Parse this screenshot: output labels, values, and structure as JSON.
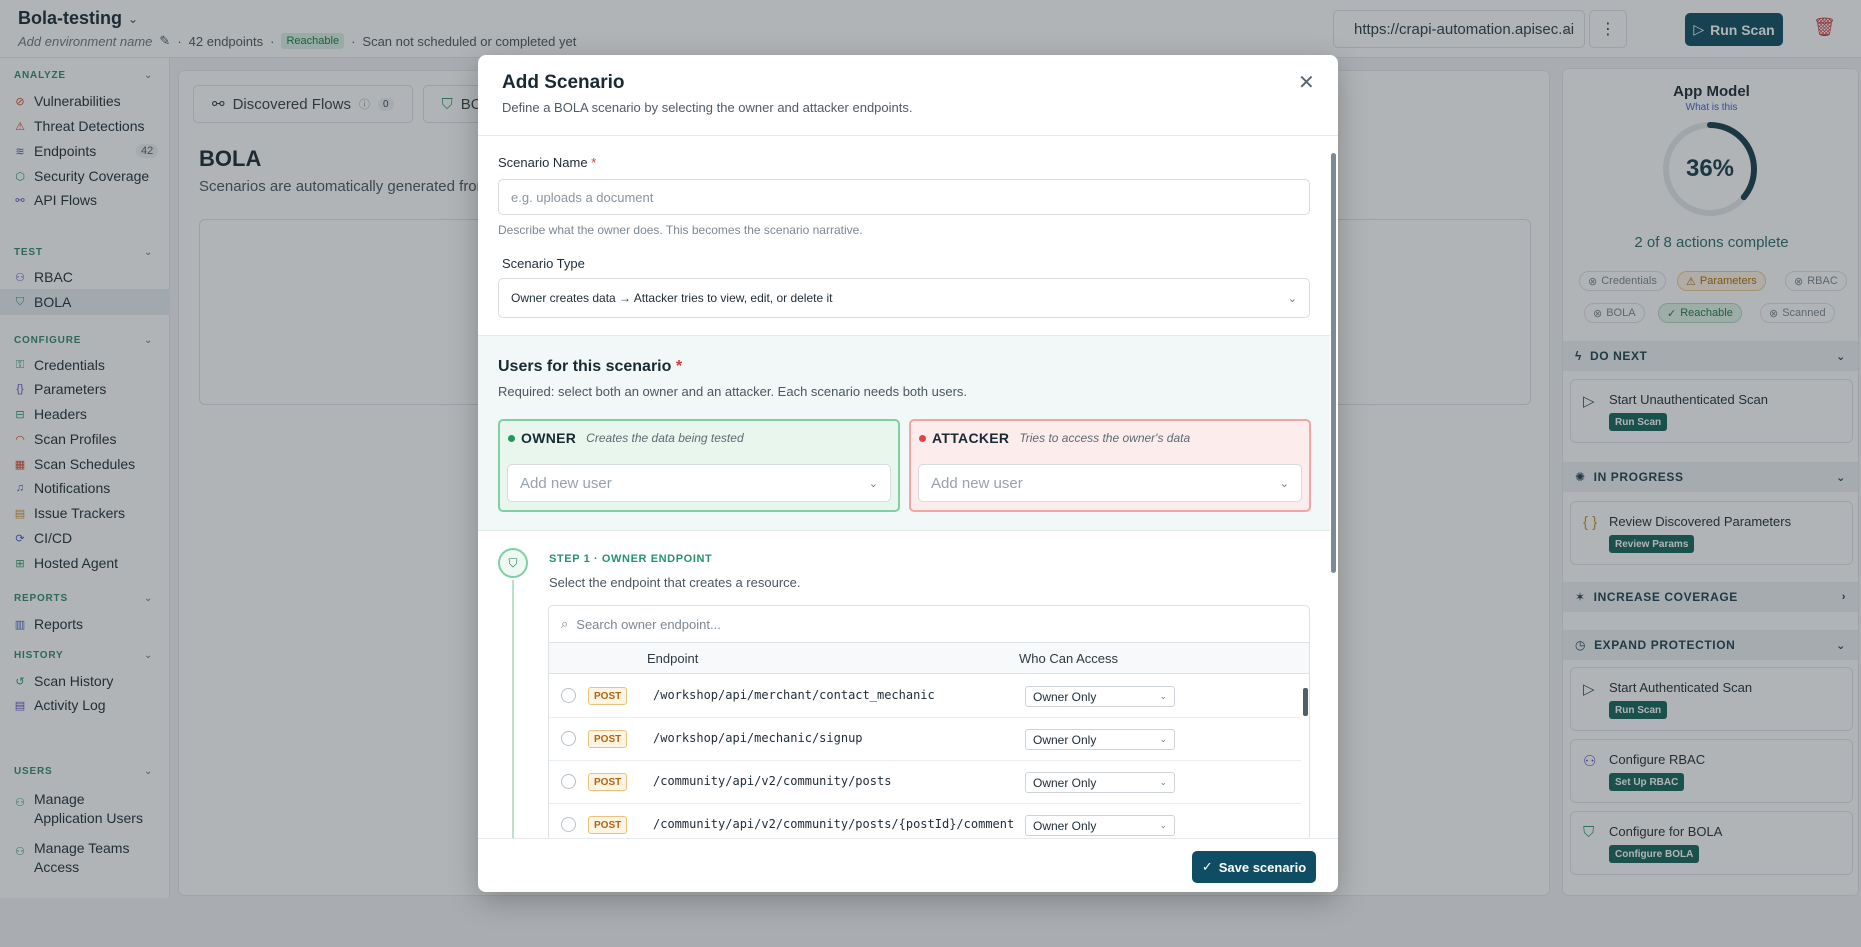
{
  "header": {
    "env_title": "Bola-testing",
    "add_env_name": "Add environment name",
    "endpoints_count": "42 endpoints",
    "reachable_badge": "Reachable",
    "scan_status": "Scan not scheduled or completed yet",
    "url": "https://crapi-automation.apisec.ai",
    "run_scan": "Run Scan"
  },
  "sidebar": {
    "sections": {
      "analyze": "ANALYZE",
      "test": "TEST",
      "configure": "CONFIGURE",
      "reports": "REPORTS",
      "history": "HISTORY",
      "users": "USERS"
    },
    "items": {
      "vulnerabilities": "Vulnerabilities",
      "threat_detections": "Threat Detections",
      "endpoints": "Endpoints",
      "endpoints_count": "42",
      "security_coverage": "Security Coverage",
      "api_flows": "API Flows",
      "rbac": "RBAC",
      "bola": "BOLA",
      "credentials": "Credentials",
      "parameters": "Parameters",
      "headers": "Headers",
      "scan_profiles": "Scan Profiles",
      "scan_schedules": "Scan Schedules",
      "notifications": "Notifications",
      "issue_trackers": "Issue Trackers",
      "cicd": "CI/CD",
      "hosted_agent": "Hosted Agent",
      "reports": "Reports",
      "scan_history": "Scan History",
      "activity_log": "Activity Log",
      "manage_app_users": "Manage Application Users",
      "manage_teams": "Manage Teams Access"
    }
  },
  "main": {
    "tab_discovered": "Discovered Flows",
    "tab_discovered_count": "0",
    "tab_bola": "BO",
    "title": "BOLA",
    "subtitle": "Scenarios are automatically generated from"
  },
  "right_panel": {
    "title": "App Model",
    "what_link": "What is this",
    "percent": "36%",
    "percent_value": 36,
    "actions_complete": "2 of 8 actions complete",
    "chips": {
      "credentials": "Credentials",
      "parameters": "Parameters",
      "rbac": "RBAC",
      "bola": "BOLA",
      "reachable": "Reachable",
      "scanned": "Scanned"
    },
    "sections": {
      "do_next": "DO NEXT",
      "in_progress": "IN PROGRESS",
      "increase_coverage": "INCREASE COVERAGE",
      "expand_protection": "EXPAND PROTECTION"
    },
    "cards": {
      "unauth_scan": "Start Unauthenticated Scan",
      "unauth_btn": "Run Scan",
      "review_params": "Review Discovered Parameters",
      "review_btn": "Review Params",
      "auth_scan": "Start Authenticated Scan",
      "auth_btn": "Run Scan",
      "config_rbac": "Configure RBAC",
      "rbac_btn": "Set Up RBAC",
      "config_bola": "Configure for BOLA",
      "bola_btn": "Configure BOLA"
    }
  },
  "modal": {
    "title": "Add Scenario",
    "subtitle": "Define a BOLA scenario by selecting the owner and attacker endpoints.",
    "scenario_name_label": "Scenario Name",
    "scenario_name_placeholder": "e.g. uploads a document",
    "scenario_name_hint": "Describe what the owner does. This becomes the scenario narrative.",
    "scenario_type_label": "Scenario Type",
    "scenario_type_value": "Owner creates data → Attacker tries to view, edit, or delete it",
    "users_title": "Users for this scenario",
    "users_sub": "Required: select both an owner and an attacker. Each scenario needs both users.",
    "owner_label": "OWNER",
    "owner_desc": "Creates the data being tested",
    "owner_placeholder": "Add new user",
    "attacker_label": "ATTACKER",
    "attacker_desc": "Tries to access the owner's data",
    "attacker_placeholder": "Add new user",
    "step_title": "STEP 1 · OWNER ENDPOINT",
    "step_sub": "Select the endpoint that creates a resource.",
    "search_placeholder": "Search owner endpoint...",
    "col_endpoint": "Endpoint",
    "col_access": "Who Can Access",
    "rows": [
      {
        "method": "POST",
        "path": "/workshop/api/merchant/contact_mechanic",
        "access": "Owner Only"
      },
      {
        "method": "POST",
        "path": "/workshop/api/mechanic/signup",
        "access": "Owner Only"
      },
      {
        "method": "POST",
        "path": "/community/api/v2/community/posts",
        "access": "Owner Only"
      },
      {
        "method": "POST",
        "path": "/community/api/v2/community/posts/{postId}/comment",
        "access": "Owner Only"
      }
    ],
    "save_button": "Save scenario"
  },
  "colors": {
    "primary": "#0e4d63",
    "accent_green": "#25946a",
    "danger": "#d23a3a"
  }
}
